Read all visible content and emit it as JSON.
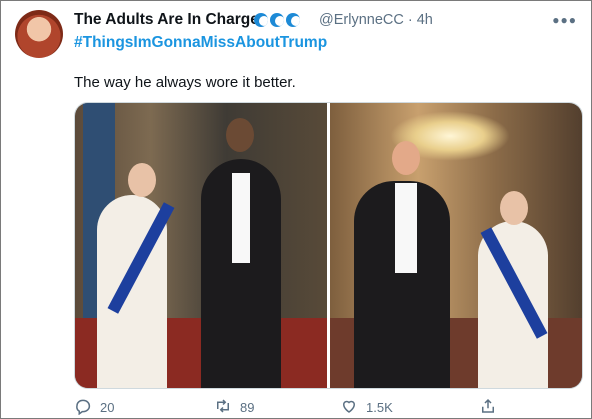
{
  "tweet": {
    "author_name": "The Adults Are In Charge",
    "author_emojis": [
      "wave-emoji",
      "wave-emoji",
      "wave-emoji"
    ],
    "handle": "@ErlynneCC",
    "separator": "·",
    "time": "4h",
    "hashtag": "#ThingsImGonnaMissAboutTrump",
    "text": "The way he always wore it better."
  },
  "actions": {
    "replies": "20",
    "retweets": "89",
    "likes": "1.5K"
  },
  "colors": {
    "link": "#1b95e0",
    "muted": "#5b7083",
    "border": "#cfd9de"
  }
}
